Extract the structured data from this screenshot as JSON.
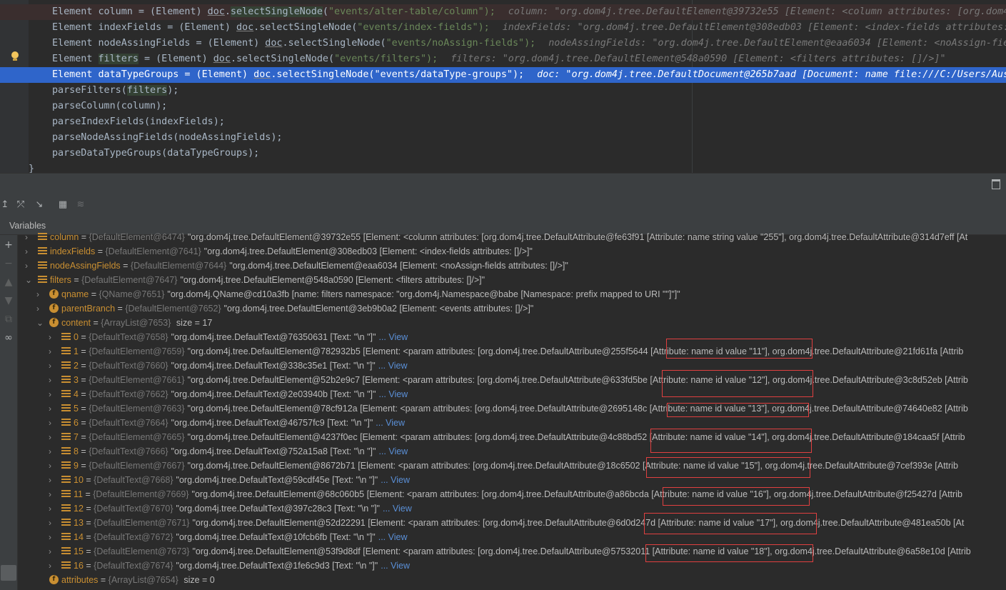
{
  "editor": {
    "lines": [
      {
        "segments": [
          {
            "t": "Element column = (Element) "
          },
          {
            "t": "doc",
            "c": "und"
          },
          {
            "t": "."
          },
          {
            "t": "selectSingleNode",
            "c": "hl"
          },
          {
            "t": "("
          },
          {
            "t": "\"events/",
            "c": "str"
          },
          {
            "t": "alter-table",
            "c": "str"
          },
          {
            "t": "/",
            "c": "str"
          },
          {
            "t": "column",
            "c": "str"
          },
          {
            "t": "\");",
            "c": "str"
          }
        ],
        "hint": "column: \"org.dom4j.tree.DefaultElement@39732e55 [Element: <column attributes: [org.dom4j",
        "kind": "err"
      },
      {
        "segments": [
          {
            "t": "Element indexFields = (Element) "
          },
          {
            "t": "doc",
            "c": "und"
          },
          {
            "t": ".selectSingleNode("
          },
          {
            "t": "\"events/",
            "c": "str"
          },
          {
            "t": "index-fields",
            "c": "str"
          },
          {
            "t": "\");",
            "c": "str"
          }
        ],
        "hint": "indexFields: \"org.dom4j.tree.DefaultElement@308edb03 [Element: <index-fields attributes:",
        "kind": "normal"
      },
      {
        "segments": [
          {
            "t": "Element nodeAssingFields = (Element) "
          },
          {
            "t": "doc",
            "c": "und"
          },
          {
            "t": ".selectSingleNode("
          },
          {
            "t": "\"events/",
            "c": "str"
          },
          {
            "t": "noAssign-fields",
            "c": "str"
          },
          {
            "t": "\");",
            "c": "str"
          }
        ],
        "hint": "nodeAssingFields: \"org.dom4j.tree.DefaultElement@eaa6034 [Element: <noAssign-fiel",
        "kind": "normal"
      },
      {
        "segments": [
          {
            "t": "Element "
          },
          {
            "t": "filters",
            "c": "hl"
          },
          {
            "t": " = (Element) "
          },
          {
            "t": "doc",
            "c": "und"
          },
          {
            "t": ".selectSingleNode("
          },
          {
            "t": "\"events/",
            "c": "str"
          },
          {
            "t": "filters",
            "c": "str"
          },
          {
            "t": "\");",
            "c": "str"
          }
        ],
        "hint": "filters: \"org.dom4j.tree.DefaultElement@548a0590 [Element: <filters attributes: []/>]\"",
        "kind": "normal"
      },
      {
        "segments": [
          {
            "t": "Element dataTypeGroups = (Element) "
          },
          {
            "t": "doc",
            "c": "und"
          },
          {
            "t": ".selectSingleNode("
          },
          {
            "t": "\"events/dataType-groups\");"
          }
        ],
        "hint": "doc: \"org.dom4j.tree.DefaultDocument@265b7aad [Document: name file:///C:/Users/Ausw",
        "kind": "sel"
      },
      {
        "segments": [
          {
            "t": "parseFilters("
          },
          {
            "t": "filters",
            "c": "hl"
          },
          {
            "t": ");"
          }
        ],
        "hint": "",
        "kind": "normal"
      },
      {
        "segments": [
          {
            "t": "parseColumn(column);"
          }
        ],
        "hint": "",
        "kind": "normal"
      },
      {
        "segments": [
          {
            "t": "parseIndexFields(indexFields);"
          }
        ],
        "hint": "",
        "kind": "normal"
      },
      {
        "segments": [
          {
            "t": "parseNodeAssingFields(nodeAssingFields);"
          }
        ],
        "hint": "",
        "kind": "normal"
      },
      {
        "segments": [
          {
            "t": "parseDataTypeGroups(dataTypeGroups);"
          }
        ],
        "hint": "",
        "kind": "normal"
      },
      {
        "segments": [
          {
            "t": "}"
          }
        ],
        "hint": "",
        "kind": "brace"
      }
    ]
  },
  "panel": {
    "title": "Variables"
  },
  "tree": [
    {
      "lvl": 0,
      "chev": "›",
      "icon": "arr",
      "name": "column",
      "type": "{DefaultElement@6474}",
      "val": "\"org.dom4j.tree.DefaultElement@39732e55 [Element: <column attributes: [org.dom4j.tree.DefaultAttribute@fe63f91 [Attribute: name string value \"255\"], org.dom4j.tree.DefaultAttribute@314d7eff [At",
      "view": ""
    },
    {
      "lvl": 0,
      "chev": "›",
      "icon": "arr",
      "name": "indexFields",
      "type": "{DefaultElement@7641}",
      "val": "\"org.dom4j.tree.DefaultElement@308edb03 [Element: <index-fields attributes: []/>]\"",
      "view": ""
    },
    {
      "lvl": 0,
      "chev": "›",
      "icon": "arr",
      "name": "nodeAssingFields",
      "type": "{DefaultElement@7644}",
      "val": "\"org.dom4j.tree.DefaultElement@eaa6034 [Element: <noAssign-fields attributes: []/>]\"",
      "view": ""
    },
    {
      "lvl": 0,
      "chev": "⌄",
      "icon": "arr",
      "name": "filters",
      "type": "{DefaultElement@7647}",
      "val": "\"org.dom4j.tree.DefaultElement@548a0590 [Element: <filters attributes: []/>]\"",
      "view": ""
    },
    {
      "lvl": 1,
      "chev": "›",
      "icon": "f",
      "name": "qname",
      "type": "{QName@7651}",
      "val": "\"org.dom4j.QName@cd10a3fb [name: filters namespace: \"org.dom4j.Namespace@babe [Namespace: prefix  mapped to URI \"\"]\"]\"",
      "view": ""
    },
    {
      "lvl": 1,
      "chev": "›",
      "icon": "f",
      "name": "parentBranch",
      "type": "{DefaultElement@7652}",
      "val": "\"org.dom4j.tree.DefaultElement@3eb9b0a2 [Element: <events attributes: []/>]\"",
      "view": ""
    },
    {
      "lvl": 1,
      "chev": "⌄",
      "icon": "f",
      "name": "content",
      "type": "{ArrayList@7653}",
      "val": " size = 17",
      "view": ""
    },
    {
      "lvl": 2,
      "chev": "›",
      "icon": "arr",
      "name": "0",
      "type": "{DefaultText@7658}",
      "val": "\"org.dom4j.tree.DefaultText@76350631 [Text: \"\\n        \"]\"",
      "view": "... View"
    },
    {
      "lvl": 2,
      "chev": "›",
      "icon": "arr",
      "name": "1",
      "type": "{DefaultElement@7659}",
      "val": "\"org.dom4j.tree.DefaultElement@782932b5 [Element: <param attributes: [org.dom4j.tree.DefaultAttribute@255f5644 [Attribute: name id value \"11\"], org.dom4j.tree.DefaultAttribute@21fd61fa [Attrib",
      "view": ""
    },
    {
      "lvl": 2,
      "chev": "›",
      "icon": "arr",
      "name": "2",
      "type": "{DefaultText@7660}",
      "val": "\"org.dom4j.tree.DefaultText@338c35e1 [Text: \"\\n        \"]\"",
      "view": "... View"
    },
    {
      "lvl": 2,
      "chev": "›",
      "icon": "arr",
      "name": "3",
      "type": "{DefaultElement@7661}",
      "val": "\"org.dom4j.tree.DefaultElement@52b2e9c7 [Element: <param attributes: [org.dom4j.tree.DefaultAttribute@633fd5be [Attribute: name id value \"12\"], org.dom4j.tree.DefaultAttribute@3c8d52eb [Attrib",
      "view": ""
    },
    {
      "lvl": 2,
      "chev": "›",
      "icon": "arr",
      "name": "4",
      "type": "{DefaultText@7662}",
      "val": "\"org.dom4j.tree.DefaultText@2e03940b [Text: \"\\n        \"]\"",
      "view": "... View"
    },
    {
      "lvl": 2,
      "chev": "›",
      "icon": "arr",
      "name": "5",
      "type": "{DefaultElement@7663}",
      "val": "\"org.dom4j.tree.DefaultElement@78cf912a [Element: <param attributes: [org.dom4j.tree.DefaultAttribute@2695148c [Attribute: name id value \"13\"], org.dom4j.tree.DefaultAttribute@74640e82 [Attrib",
      "view": ""
    },
    {
      "lvl": 2,
      "chev": "›",
      "icon": "arr",
      "name": "6",
      "type": "{DefaultText@7664}",
      "val": "\"org.dom4j.tree.DefaultText@46757fc9 [Text: \"\\n        \"]\"",
      "view": "... View"
    },
    {
      "lvl": 2,
      "chev": "›",
      "icon": "arr",
      "name": "7",
      "type": "{DefaultElement@7665}",
      "val": "\"org.dom4j.tree.DefaultElement@4237f0ec [Element: <param attributes: [org.dom4j.tree.DefaultAttribute@4c88bd52 [Attribute: name id value \"14\"], org.dom4j.tree.DefaultAttribute@184caa5f [Attrib",
      "view": ""
    },
    {
      "lvl": 2,
      "chev": "›",
      "icon": "arr",
      "name": "8",
      "type": "{DefaultText@7666}",
      "val": "\"org.dom4j.tree.DefaultText@752a15a8 [Text: \"\\n        \"]\"",
      "view": "... View"
    },
    {
      "lvl": 2,
      "chev": "›",
      "icon": "arr",
      "name": "9",
      "type": "{DefaultElement@7667}",
      "val": "\"org.dom4j.tree.DefaultElement@8672b71 [Element: <param attributes: [org.dom4j.tree.DefaultAttribute@18c6502 [Attribute: name id value \"15\"], org.dom4j.tree.DefaultAttribute@7cef393e [Attrib",
      "view": ""
    },
    {
      "lvl": 2,
      "chev": "›",
      "icon": "arr",
      "name": "10",
      "type": "{DefaultText@7668}",
      "val": "\"org.dom4j.tree.DefaultText@59cdf45e [Text: \"\\n        \"]\"",
      "view": "... View"
    },
    {
      "lvl": 2,
      "chev": "›",
      "icon": "arr",
      "name": "11",
      "type": "{DefaultElement@7669}",
      "val": "\"org.dom4j.tree.DefaultElement@68c060b5 [Element: <param attributes: [org.dom4j.tree.DefaultAttribute@a86bcda [Attribute: name id value \"16\"], org.dom4j.tree.DefaultAttribute@f25427d [Attrib",
      "view": ""
    },
    {
      "lvl": 2,
      "chev": "›",
      "icon": "arr",
      "name": "12",
      "type": "{DefaultText@7670}",
      "val": "\"org.dom4j.tree.DefaultText@397c28c3 [Text: \"\\n        \"]\"",
      "view": "... View"
    },
    {
      "lvl": 2,
      "chev": "›",
      "icon": "arr",
      "name": "13",
      "type": "{DefaultElement@7671}",
      "val": "\"org.dom4j.tree.DefaultElement@52d22291 [Element: <param attributes: [org.dom4j.tree.DefaultAttribute@6d0d247d [Attribute: name id value \"17\"], org.dom4j.tree.DefaultAttribute@481ea50b [At",
      "view": ""
    },
    {
      "lvl": 2,
      "chev": "›",
      "icon": "arr",
      "name": "14",
      "type": "{DefaultText@7672}",
      "val": "\"org.dom4j.tree.DefaultText@10fcb6fb [Text: \"\\n        \"]\"",
      "view": "... View"
    },
    {
      "lvl": 2,
      "chev": "›",
      "icon": "arr",
      "name": "15",
      "type": "{DefaultElement@7673}",
      "val": "\"org.dom4j.tree.DefaultElement@53f9d8df [Element: <param attributes: [org.dom4j.tree.DefaultAttribute@57532011 [Attribute: name id value \"18\"], org.dom4j.tree.DefaultAttribute@6a58e10d [Attrib",
      "view": ""
    },
    {
      "lvl": 2,
      "chev": "›",
      "icon": "arr",
      "name": "16",
      "type": "{DefaultText@7674}",
      "val": "\"org.dom4j.tree.DefaultText@1fe6c9d3 [Text: \"\\n    \"]\"",
      "view": "... View"
    },
    {
      "lvl": 1,
      "chev": "",
      "icon": "f",
      "name": "attributes",
      "type": "{ArrayList@7654}",
      "val": " size = 0",
      "view": ""
    }
  ],
  "colors": {
    "highlight_box": "#e04040",
    "selection": "#2f65ca"
  }
}
